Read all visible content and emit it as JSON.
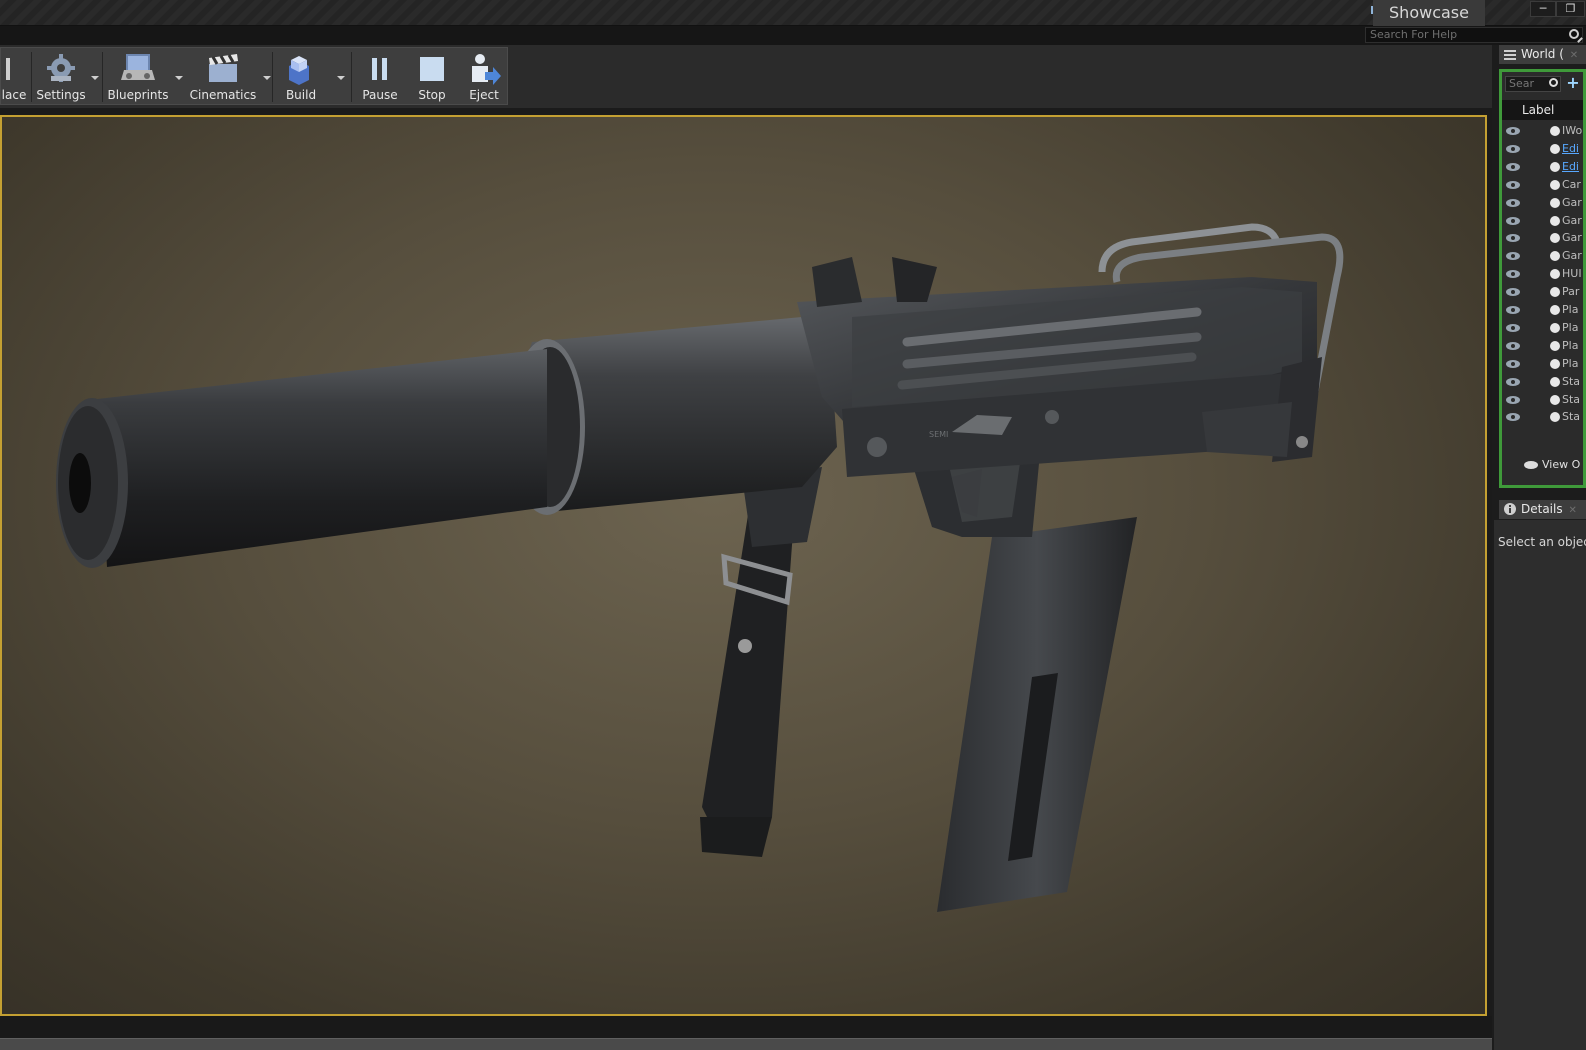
{
  "window": {
    "project_name": "Showcase",
    "controls": [
      "minimize",
      "restore",
      "close"
    ]
  },
  "help_search": {
    "placeholder": "Search For Help"
  },
  "toolbar": {
    "items": [
      {
        "label": "lace",
        "icon": "place-icon",
        "dropdown": false
      },
      {
        "label": "Settings",
        "icon": "settings-gear-icon",
        "dropdown": true
      },
      {
        "label": "Blueprints",
        "icon": "blueprints-icon",
        "dropdown": true
      },
      {
        "label": "Cinematics",
        "icon": "clapperboard-icon",
        "dropdown": true
      },
      {
        "label": "Build",
        "icon": "build-cubes-icon",
        "dropdown": true
      },
      {
        "label": "Pause",
        "icon": "pause-icon",
        "dropdown": false
      },
      {
        "label": "Stop",
        "icon": "stop-icon",
        "dropdown": false
      },
      {
        "label": "Eject",
        "icon": "eject-icon",
        "dropdown": false
      }
    ]
  },
  "viewport": {
    "content": "3D model of a submachine gun with suppressor",
    "marking": "SEMI"
  },
  "outliner": {
    "tab_label": "World (",
    "search_placeholder": "Sear",
    "column_label": "Label",
    "rows": [
      {
        "text": "IWo",
        "style": "normal"
      },
      {
        "text": "Edi",
        "style": "blue"
      },
      {
        "text": "Edi",
        "style": "blue"
      },
      {
        "text": "Car",
        "style": "normal"
      },
      {
        "text": "Gar",
        "style": "normal"
      },
      {
        "text": "Gar",
        "style": "normal"
      },
      {
        "text": "Gar",
        "style": "normal"
      },
      {
        "text": "Gar",
        "style": "normal"
      },
      {
        "text": "HUI",
        "style": "normal"
      },
      {
        "text": "Par",
        "style": "normal"
      },
      {
        "text": "Pla",
        "style": "normal"
      },
      {
        "text": "Pla",
        "style": "normal"
      },
      {
        "text": "Pla",
        "style": "normal"
      },
      {
        "text": "Pla",
        "style": "normal"
      },
      {
        "text": "Sta",
        "style": "normal"
      },
      {
        "text": "Sta",
        "style": "normal"
      },
      {
        "text": "Sta",
        "style": "normal"
      }
    ],
    "view_options_label": "View O"
  },
  "details": {
    "tab_label": "Details",
    "empty_message": "Select an object"
  },
  "colors": {
    "viewport_border": "#c4a032",
    "outliner_highlight": "#3f9a3a",
    "link_blue": "#58a8ff"
  }
}
